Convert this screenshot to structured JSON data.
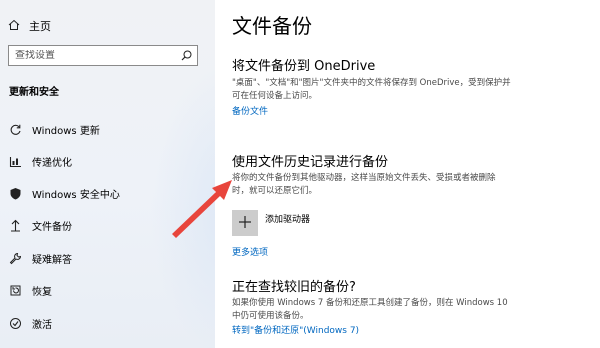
{
  "sidebar": {
    "home_label": "主页",
    "search_placeholder": "查找设置",
    "section_title": "更新和安全",
    "items": [
      {
        "label": "Windows 更新",
        "icon": "refresh-icon"
      },
      {
        "label": "传递优化",
        "icon": "delivery-optimization-icon"
      },
      {
        "label": "Windows 安全中心",
        "icon": "shield-icon"
      },
      {
        "label": "文件备份",
        "icon": "backup-arrow-icon"
      },
      {
        "label": "疑难解答",
        "icon": "wrench-icon"
      },
      {
        "label": "恢复",
        "icon": "recovery-icon"
      },
      {
        "label": "激活",
        "icon": "checkmark-circle-icon"
      }
    ]
  },
  "main": {
    "title": "文件备份",
    "onedrive": {
      "heading": "将文件备份到 OneDrive",
      "desc_line1": "\"桌面\"、\"文档\"和\"图片\"文件夹中的文件将保存到 OneDrive，受到保护并",
      "desc_line2": "可在任何设备上访问。",
      "link": "备份文件"
    },
    "history": {
      "heading": "使用文件历史记录进行备份",
      "desc_line1": "将你的文件备份到其他驱动器，这样当原始文件丢失、受损或者被删除",
      "desc_line2": "时，就可以还原它们。",
      "add_drive_label": "添加驱动器",
      "more_options_link": "更多选项"
    },
    "older": {
      "heading": "正在查找较旧的备份?",
      "desc_line1": "如果你使用 Windows 7 备份和还原工具创建了备份，则在 Windows 10",
      "desc_line2": "中仍可使用该备份。",
      "link": "转到\"备份和还原\"(Windows 7)"
    }
  },
  "colors": {
    "link": "#0067c0",
    "annotation_arrow": "#e8453c",
    "add_button_bg": "#cccccc"
  }
}
